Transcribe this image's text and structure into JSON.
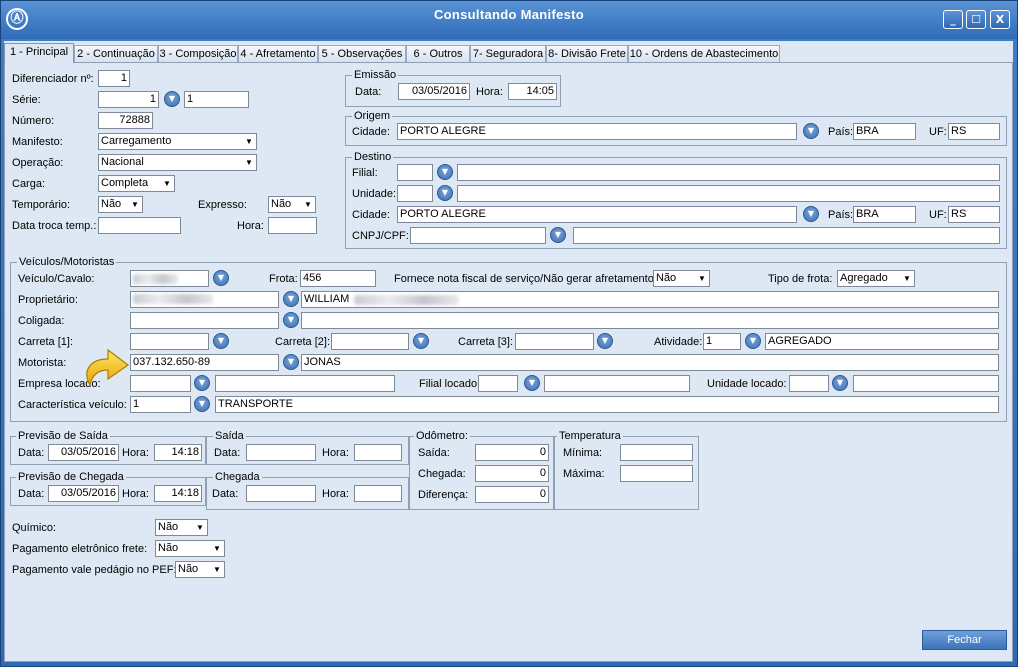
{
  "window": {
    "title": "Consultando Manifesto",
    "minimize": "_",
    "close": "X"
  },
  "tabs": [
    {
      "label": "1 - Principal"
    },
    {
      "label": "2 - Continuação"
    },
    {
      "label": "3 - Composição"
    },
    {
      "label": "4 - Afretamento"
    },
    {
      "label": "5 - Observações"
    },
    {
      "label": "6 - Outros"
    },
    {
      "label": "7- Seguradora"
    },
    {
      "label": "8- Divisão Frete"
    },
    {
      "label": "10 - Ordens de Abastecimento"
    }
  ],
  "left": {
    "diferenciador_label": "Diferenciador nº:",
    "diferenciador": "1",
    "serie_label": "Série:",
    "serie": "1",
    "serie_desc": "1",
    "numero_label": "Número:",
    "numero": "72888",
    "manifesto_label": "Manifesto:",
    "manifesto": "Carregamento",
    "operacao_label": "Operação:",
    "operacao": "Nacional",
    "carga_label": "Carga:",
    "carga": "Completa",
    "temporario_label": "Temporário:",
    "temporario": "Não",
    "expresso_label": "Expresso:",
    "expresso": "Não",
    "data_troca_label": "Data troca temp.:",
    "data_troca": "",
    "hora_label": "Hora:",
    "hora": ""
  },
  "emissao": {
    "title": "Emissão",
    "data_label": "Data:",
    "data": "03/05/2016",
    "hora_label": "Hora:",
    "hora": "14:05"
  },
  "origem": {
    "title": "Origem",
    "cidade_label": "Cidade:",
    "cidade": "PORTO ALEGRE",
    "pais_label": "País:",
    "pais": "BRA",
    "uf_label": "UF:",
    "uf": "RS"
  },
  "destino": {
    "title": "Destino",
    "filial_label": "Filial:",
    "filial": "",
    "filial_desc": "",
    "unidade_label": "Unidade:",
    "unidade": "",
    "unidade_desc": "",
    "cidade_label": "Cidade:",
    "cidade": "PORTO ALEGRE",
    "pais_label": "País:",
    "pais": "BRA",
    "uf_label": "UF:",
    "uf": "RS",
    "cnpj_label": "CNPJ/CPF:",
    "cnpj": "",
    "cnpj_desc": ""
  },
  "veiculos": {
    "title": "Veículos/Motoristas",
    "veiculo_label": "Veículo/Cavalo:",
    "frota_label": "Frota:",
    "frota": "456",
    "fornece_label": "Fornece nota fiscal de serviço/Não gerar afretamento:",
    "fornece": "Não",
    "tipo_frota_label": "Tipo de frota:",
    "tipo_frota": "Agregado",
    "proprietario_label": "Proprietário:",
    "proprietario_nome": "WILLIAM",
    "coligada_label": "Coligada:",
    "carreta1_label": "Carreta [1]:",
    "carreta2_label": "Carreta [2]:",
    "carreta3_label": "Carreta [3]:",
    "atividade_label": "Atividade:",
    "atividade": "1",
    "atividade_desc": "AGREGADO",
    "motorista_label": "Motorista:",
    "motorista": "037.132.650-89",
    "motorista_nome": "JONAS",
    "empresa_locado_label": "Empresa locado:",
    "filial_locado_label": "Filial locado:",
    "unidade_locado_label": "Unidade locado:",
    "caracteristica_label": "Característica veículo:",
    "caracteristica": "1",
    "caracteristica_desc": "TRANSPORTE"
  },
  "previsao_saida": {
    "title": "Previsão de Saída",
    "data_label": "Data:",
    "data": "03/05/2016",
    "hora_label": "Hora:",
    "hora": "14:18"
  },
  "saida": {
    "title": "Saída",
    "data_label": "Data:",
    "hora_label": "Hora:"
  },
  "previsao_chegada": {
    "title": "Previsão de Chegada",
    "data_label": "Data:",
    "data": "03/05/2016",
    "hora_label": "Hora:",
    "hora": "14:18"
  },
  "chegada": {
    "title": "Chegada",
    "data_label": "Data:",
    "hora_label": "Hora:"
  },
  "odometro": {
    "title": "Odômetro:",
    "saida_label": "Saída:",
    "saida": "0",
    "chegada_label": "Chegada:",
    "chegada": "0",
    "diferenca_label": "Diferença:",
    "diferenca": "0"
  },
  "temperatura": {
    "title": "Temperatura",
    "minima_label": "Mínima:",
    "maxima_label": "Máxima:"
  },
  "bottom": {
    "quimico_label": "Químico:",
    "quimico": "Não",
    "pag_eletronico_label": "Pagamento eletrônico frete:",
    "pag_eletronico": "Não",
    "pag_vale_label": "Pagamento vale pedágio no PEF:",
    "pag_vale": "Não"
  },
  "fechar": "Fechar"
}
